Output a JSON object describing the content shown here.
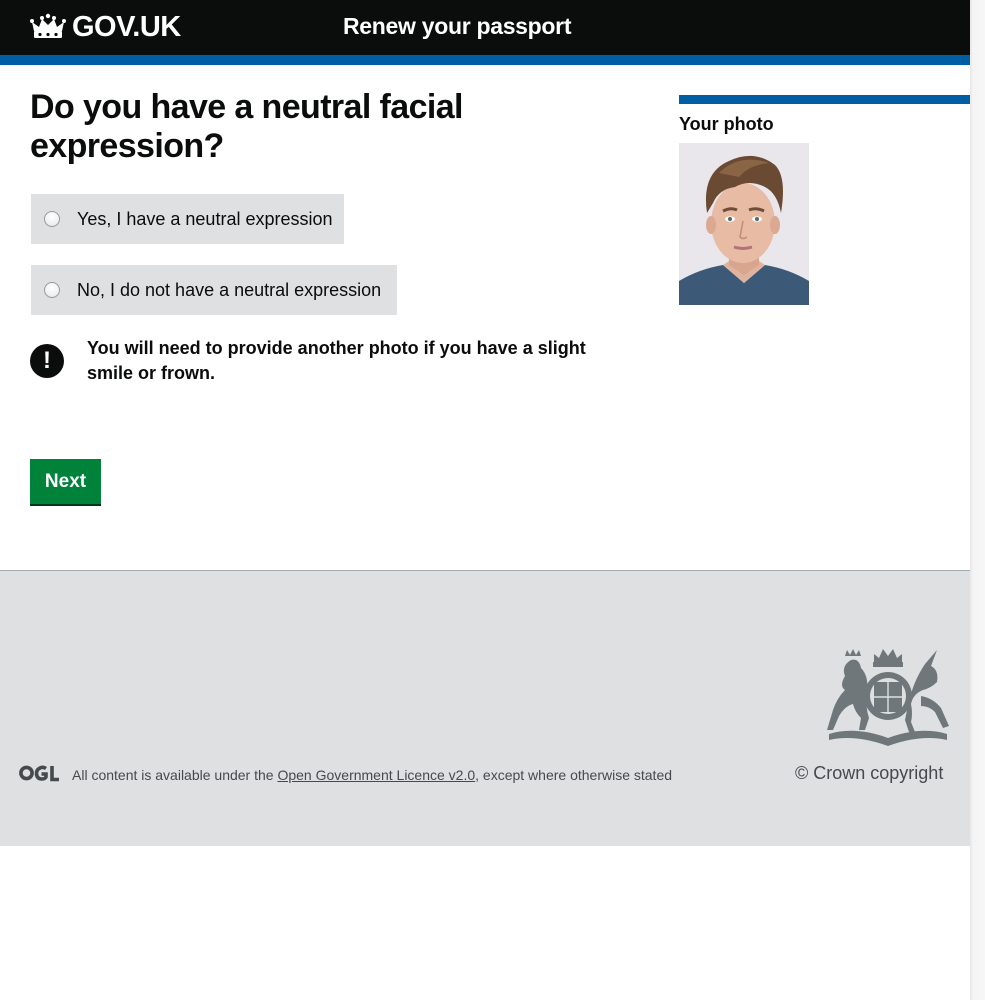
{
  "header": {
    "logo_text": "GOV.UK",
    "service_name": "Renew your passport"
  },
  "main": {
    "question": "Do you have a neutral facial expression?",
    "options": [
      {
        "label": "Yes, I have a neutral expression",
        "selected": false
      },
      {
        "label": "No, I do not have a neutral expression",
        "selected": false
      }
    ],
    "warning_icon": "!",
    "warning_text": "You will need to provide another photo if you have a slight smile or frown.",
    "next_label": "Next"
  },
  "sidebar": {
    "title": "Your photo"
  },
  "footer": {
    "licence_prefix": "All content is available under the ",
    "licence_link": "Open Government Licence v2.0",
    "licence_suffix": ", except where otherwise stated",
    "copyright": "© Crown copyright"
  },
  "colors": {
    "header_bg": "#0b0c0c",
    "brand_blue": "#005ea5",
    "button_green": "#00823b",
    "option_bg": "#dee0e2",
    "footer_bg": "#dee0e2"
  },
  "icons": [
    "crown-icon",
    "warning-icon",
    "ogl-logo-icon",
    "royal-coat-of-arms-icon"
  ]
}
